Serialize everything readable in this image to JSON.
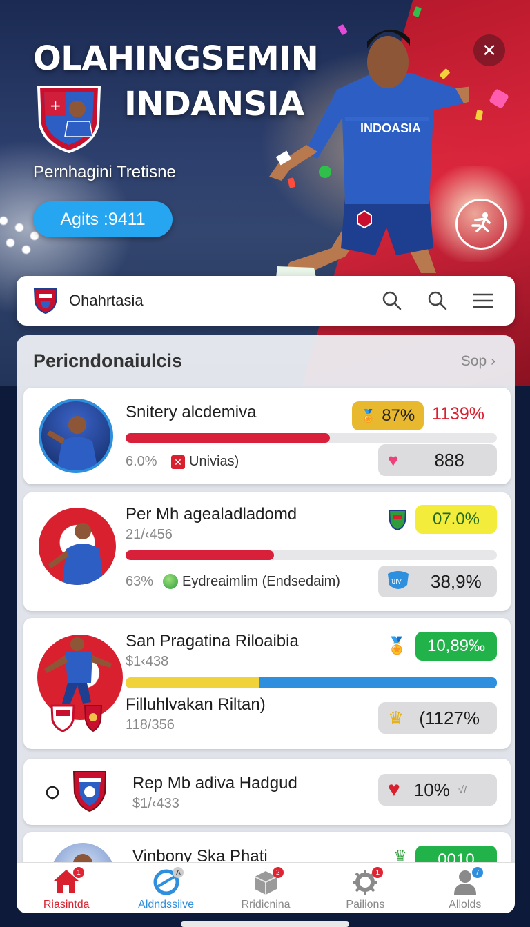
{
  "hero": {
    "title_line1": "OLAHINGSEMIN",
    "title_line2": "INDANSIA",
    "subtitle": "Pernhagini Tretisne",
    "pill_label": "Agits :9411",
    "jersey_text": "INDOASIA"
  },
  "search": {
    "brand_label": "Ohahrtasia"
  },
  "section": {
    "title": "Pericndonaiulcis",
    "more_label": "Sop"
  },
  "cards": [
    {
      "name": "Snitery alcdemiva",
      "sub_pct": "6.0%",
      "sub_tag": "Univias)",
      "badge": "87%",
      "change": "1139%",
      "stat": "888",
      "progress": 0.55,
      "progress_color": "#d9203a"
    },
    {
      "name": "Per Mh agealadladomd",
      "sub_value": "21/‹456",
      "sub_pct": "63%",
      "sub_tag": "Eydreaimlim (Endsedaim)",
      "badge": "07.0%",
      "stat": "38,9%",
      "progress": 0.4,
      "progress_color": "#d9203a"
    },
    {
      "name": "San Pragatina Riloaibia",
      "sub_value": "$1‹438",
      "sub_name": "Filluhlvakan Riltan)",
      "sub_value2": "118/356",
      "badge": "10,89‰",
      "stat": "(1127%",
      "progress_split": 0.36,
      "progress_colors": [
        "#f0d23a",
        "#2e8fde"
      ]
    },
    {
      "name": "Rep Mb adiva Hadgud",
      "sub_value": "$1/‹433",
      "stat": "10%",
      "stat_suffix": "√/"
    },
    {
      "name": "Vinbony Ska Phati",
      "badge": "0010"
    }
  ],
  "nav": [
    {
      "label": "Riasintda",
      "icon": "home-icon",
      "active": true
    },
    {
      "label": "Aldndssiive",
      "icon": "globe-icon",
      "active": false
    },
    {
      "label": "Rridicnina",
      "icon": "box-icon",
      "active": false
    },
    {
      "label": "Pailions",
      "icon": "gear-icon",
      "active": false
    },
    {
      "label": "Allolds",
      "icon": "user-icon",
      "active": false
    }
  ],
  "colors": {
    "accent_blue": "#26a6f0",
    "brand_red": "#d9202f",
    "badge_gold": "#e8b92e",
    "badge_yellow": "#f3ec3a",
    "badge_green": "#22b24a"
  }
}
